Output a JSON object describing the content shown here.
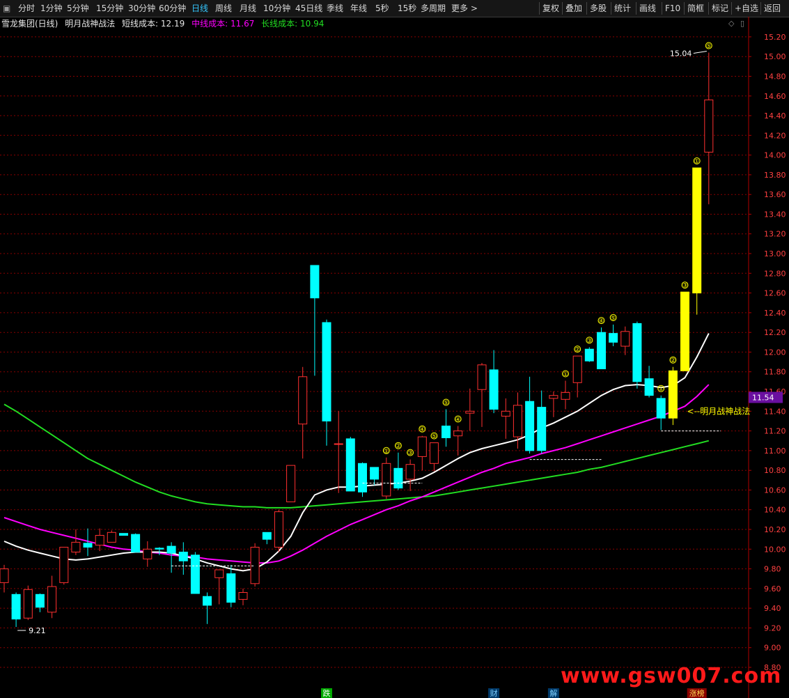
{
  "toolbar": {
    "window_icon": "square-icon",
    "left_items": [
      "分时",
      "1分钟",
      "5分钟",
      "15分钟",
      "30分钟",
      "60分钟",
      "日线",
      "周线",
      "月线",
      "10分钟",
      "45日线",
      "季线",
      "年线",
      "5秒",
      "15秒",
      "多周期",
      "更多 >"
    ],
    "active_item": "日线",
    "right_items": [
      "复权",
      "叠加",
      "多股",
      "统计",
      "画线",
      "F10",
      "简框",
      "标记",
      "+自选",
      "返回"
    ]
  },
  "info": {
    "stock_name": "雪龙集团(日线)",
    "indicator_name": "明月战神战法",
    "short_cost_label": "短线成本:",
    "short_cost_value": "12.19",
    "mid_cost_label": "中线成本:",
    "mid_cost_value": "11.67",
    "long_cost_label": "长线成本:",
    "long_cost_value": "10.94"
  },
  "colors": {
    "up": "#ff3030",
    "down": "#00ffff",
    "signal": "#ffff00",
    "short_line": "#ffffff",
    "mid_line": "#ff00ff",
    "long_line": "#22dd22",
    "grid": "#8b0000",
    "axis_text": "#ff4040",
    "current_price_bg": "#6a0fa0"
  },
  "axis": {
    "labels": [
      "15.20",
      "15.00",
      "14.80",
      "14.60",
      "14.40",
      "14.20",
      "14.00",
      "13.80",
      "13.60",
      "13.40",
      "13.20",
      "13.00",
      "12.80",
      "12.60",
      "12.40",
      "12.20",
      "12.00",
      "11.80",
      "11.60",
      "11.40",
      "11.20",
      "11.00",
      "10.80",
      "10.60",
      "10.40",
      "10.20",
      "10.00",
      "9.80",
      "9.60",
      "9.40",
      "9.20",
      "9.00",
      "8.80"
    ],
    "current_price": "11.54"
  },
  "annotations": {
    "high_label": "15.04",
    "low_label": "9.21",
    "strategy_label": "<--明月战神战法"
  },
  "chart_data": {
    "type": "candlestick",
    "ylim": [
      8.8,
      15.27
    ],
    "ohlc": [
      [
        9.66,
        9.84,
        9.56,
        9.8
      ],
      [
        9.54,
        9.56,
        9.21,
        9.29
      ],
      [
        9.3,
        9.63,
        9.28,
        9.59
      ],
      [
        9.54,
        9.55,
        9.36,
        9.41
      ],
      [
        9.36,
        9.73,
        9.3,
        9.62
      ],
      [
        9.66,
        10.02,
        9.64,
        10.02
      ],
      [
        9.97,
        10.2,
        9.94,
        10.07
      ],
      [
        10.06,
        10.21,
        9.93,
        10.02
      ],
      [
        10.04,
        10.21,
        9.98,
        10.14
      ],
      [
        10.07,
        10.19,
        10.07,
        10.17
      ],
      [
        10.16,
        10.16,
        10.14,
        10.14
      ],
      [
        10.15,
        10.16,
        9.97,
        9.97
      ],
      [
        9.9,
        10.08,
        9.82,
        10.0
      ],
      [
        10.01,
        10.02,
        9.94,
        10.0
      ],
      [
        10.03,
        10.07,
        9.76,
        9.96
      ],
      [
        9.97,
        10.07,
        9.74,
        9.88
      ],
      [
        9.94,
        9.97,
        9.55,
        9.55
      ],
      [
        9.52,
        9.56,
        9.24,
        9.43
      ],
      [
        9.71,
        9.77,
        9.44,
        9.79
      ],
      [
        9.75,
        9.84,
        9.41,
        9.46
      ],
      [
        9.49,
        9.6,
        9.43,
        9.56
      ],
      [
        9.65,
        10.06,
        9.62,
        10.02
      ],
      [
        10.17,
        10.13,
        10.05,
        10.1
      ],
      [
        10.02,
        10.4,
        9.97,
        10.38
      ],
      [
        10.48,
        10.82,
        10.48,
        10.85
      ],
      [
        11.27,
        11.85,
        10.92,
        11.75
      ],
      [
        12.88,
        12.88,
        11.76,
        12.55
      ],
      [
        12.3,
        12.33,
        11.05,
        11.3
      ],
      [
        11.07,
        11.4,
        10.57,
        11.07
      ],
      [
        11.12,
        11.14,
        10.6,
        10.59
      ],
      [
        10.87,
        10.88,
        10.53,
        10.58
      ],
      [
        10.83,
        10.83,
        10.65,
        10.71
      ],
      [
        10.54,
        10.93,
        10.51,
        10.87
      ],
      [
        10.82,
        10.98,
        10.6,
        10.62
      ],
      [
        10.71,
        10.91,
        10.59,
        10.86
      ],
      [
        10.94,
        11.15,
        10.8,
        11.14
      ],
      [
        10.87,
        11.08,
        10.79,
        11.08
      ],
      [
        11.25,
        11.42,
        11.04,
        11.13
      ],
      [
        11.15,
        11.25,
        10.95,
        11.2
      ],
      [
        11.38,
        11.63,
        11.2,
        11.4
      ],
      [
        11.62,
        11.89,
        11.24,
        11.87
      ],
      [
        11.82,
        12.02,
        11.38,
        11.42
      ],
      [
        11.35,
        11.53,
        11.12,
        11.4
      ],
      [
        11.14,
        11.59,
        11.02,
        11.46
      ],
      [
        11.5,
        11.75,
        10.97,
        11.0
      ],
      [
        11.44,
        11.61,
        10.97,
        11.0
      ],
      [
        11.53,
        11.6,
        11.34,
        11.56
      ],
      [
        11.52,
        11.71,
        11.42,
        11.59
      ],
      [
        11.69,
        11.91,
        11.54,
        11.96
      ],
      [
        12.03,
        12.05,
        11.9,
        11.91
      ],
      [
        12.2,
        12.25,
        11.87,
        11.83
      ],
      [
        12.19,
        12.28,
        12.06,
        12.1
      ],
      [
        12.06,
        12.26,
        11.97,
        12.21
      ],
      [
        12.29,
        12.31,
        11.63,
        11.7
      ],
      [
        11.73,
        11.86,
        11.54,
        11.56
      ],
      [
        11.53,
        11.56,
        11.21,
        11.33
      ],
      [
        11.33,
        11.85,
        11.26,
        11.81
      ],
      [
        11.81,
        12.61,
        11.81,
        12.61
      ],
      [
        12.6,
        12.98,
        12.38,
        13.87
      ],
      [
        14.03,
        15.04,
        13.5,
        14.56
      ]
    ],
    "short_cost_line": [
      10.08,
      10.03,
      9.99,
      9.96,
      9.93,
      9.9,
      9.89,
      9.9,
      9.92,
      9.94,
      9.96,
      9.97,
      9.97,
      9.97,
      9.96,
      9.93,
      9.9,
      9.86,
      9.83,
      9.8,
      9.78,
      9.8,
      9.87,
      9.98,
      10.13,
      10.37,
      10.55,
      10.6,
      10.63,
      10.63,
      10.64,
      10.65,
      10.66,
      10.67,
      10.69,
      10.72,
      10.78,
      10.85,
      10.92,
      10.98,
      11.02,
      11.05,
      11.08,
      11.11,
      11.16,
      11.23,
      11.28,
      11.34,
      11.4,
      11.48,
      11.56,
      11.62,
      11.66,
      11.67,
      11.66,
      11.64,
      11.66,
      11.74,
      11.95,
      12.19
    ],
    "mid_cost_line": [
      10.32,
      10.28,
      10.24,
      10.2,
      10.17,
      10.14,
      10.11,
      10.08,
      10.05,
      10.02,
      10.0,
      9.99,
      9.97,
      9.96,
      9.94,
      9.93,
      9.92,
      9.9,
      9.89,
      9.88,
      9.87,
      9.86,
      9.86,
      9.88,
      9.93,
      9.99,
      10.06,
      10.13,
      10.19,
      10.25,
      10.3,
      10.35,
      10.4,
      10.44,
      10.49,
      10.53,
      10.58,
      10.63,
      10.68,
      10.73,
      10.78,
      10.82,
      10.87,
      10.9,
      10.93,
      10.97,
      11.0,
      11.03,
      11.07,
      11.11,
      11.15,
      11.19,
      11.23,
      11.27,
      11.31,
      11.35,
      11.4,
      11.45,
      11.55,
      11.67
    ],
    "long_cost_line": [
      11.47,
      11.4,
      11.32,
      11.24,
      11.16,
      11.08,
      11.0,
      10.92,
      10.86,
      10.8,
      10.74,
      10.68,
      10.63,
      10.58,
      10.54,
      10.51,
      10.48,
      10.46,
      10.45,
      10.44,
      10.43,
      10.43,
      10.42,
      10.42,
      10.42,
      10.43,
      10.44,
      10.45,
      10.46,
      10.47,
      10.48,
      10.49,
      10.5,
      10.51,
      10.52,
      10.53,
      10.54,
      10.56,
      10.58,
      10.6,
      10.62,
      10.64,
      10.66,
      10.68,
      10.7,
      10.72,
      10.74,
      10.76,
      10.78,
      10.81,
      10.83,
      10.86,
      10.89,
      10.92,
      10.95,
      10.98,
      11.01,
      11.04,
      11.07,
      11.1
    ],
    "yellow_bars": [
      56,
      57,
      58
    ],
    "markers": [
      {
        "i": 32,
        "label": "①"
      },
      {
        "i": 33,
        "label": "②"
      },
      {
        "i": 34,
        "label": "③"
      },
      {
        "i": 35,
        "label": "④"
      },
      {
        "i": 36,
        "label": "⑤"
      },
      {
        "i": 37,
        "label": "⑤"
      },
      {
        "i": 38,
        "label": "④"
      },
      {
        "i": 47,
        "label": "①"
      },
      {
        "i": 48,
        "label": "②"
      },
      {
        "i": 49,
        "label": "③"
      },
      {
        "i": 50,
        "label": "④"
      },
      {
        "i": 51,
        "label": "⑤"
      },
      {
        "i": 55,
        "label": "①"
      },
      {
        "i": 56,
        "label": "②"
      },
      {
        "i": 57,
        "label": "③"
      },
      {
        "i": 58,
        "label": "①"
      },
      {
        "i": 59,
        "label": "⑤"
      }
    ],
    "bottom_tags": [
      {
        "i": 27,
        "text": "跌",
        "bg": "#00aa00",
        "fg": "#ffffff"
      },
      {
        "i": 41,
        "text": "财",
        "bg": "#003a6a",
        "fg": "#7fd0ff"
      },
      {
        "i": 46,
        "text": "解",
        "bg": "#003a6a",
        "fg": "#7fd0ff"
      },
      {
        "i": 58,
        "text": "涨榜",
        "bg": "#8a0000",
        "fg": "#ffdd55"
      }
    ]
  },
  "watermark": "www.gsw007.com"
}
